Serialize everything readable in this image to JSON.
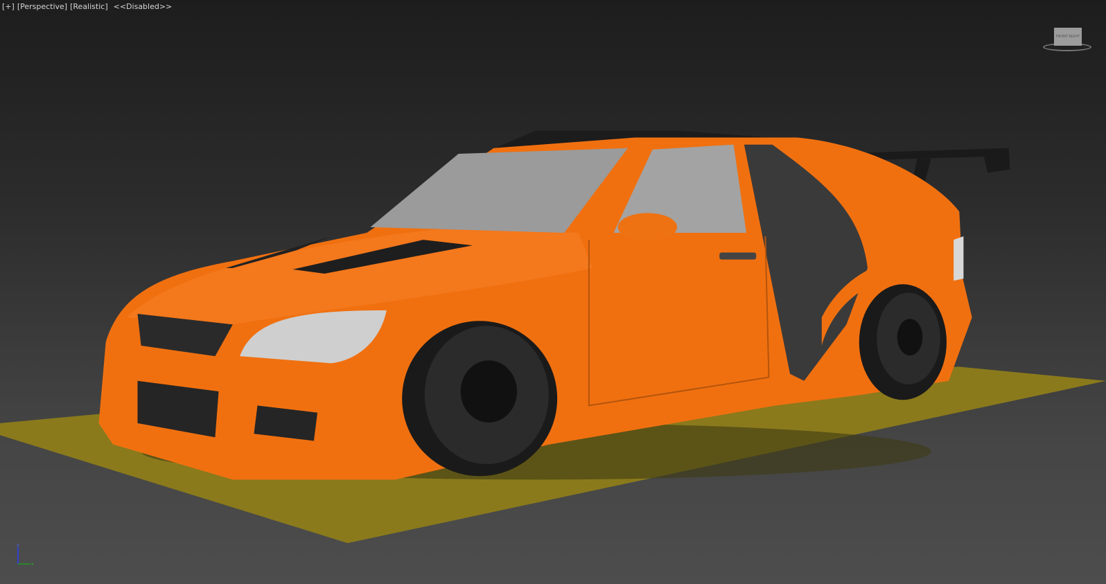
{
  "viewport": {
    "labels": {
      "plus": "[+]",
      "view": "[Perspective]",
      "shading": "[Realistic]",
      "status": "<<Disabled>>"
    },
    "viewcube": {
      "label": "FRONT RIGHT"
    },
    "axis_tripod": {
      "z": "z",
      "x": "x"
    },
    "colors": {
      "body": "#f07010",
      "ground": "#8a7a1c",
      "background_top": "#1d1d1d",
      "background_bottom": "#4d4d4d"
    }
  }
}
